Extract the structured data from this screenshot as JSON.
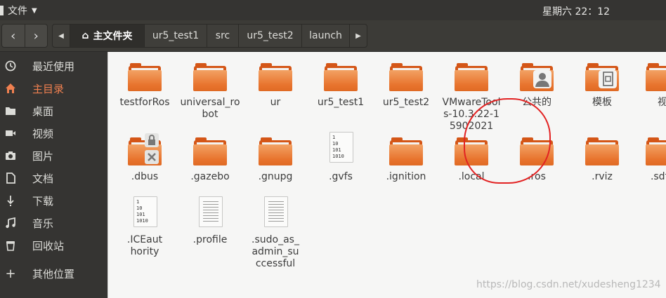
{
  "topbar": {
    "app_menu": "文件",
    "clock": "星期六 22：12"
  },
  "toolbar": {
    "path": [
      "主文件夹",
      "ur5_test1",
      "src",
      "ur5_test2",
      "launch"
    ]
  },
  "sidebar": {
    "items": [
      {
        "label": "最近使用",
        "icon": "clock-icon"
      },
      {
        "label": "主目录",
        "icon": "home-icon"
      },
      {
        "label": "桌面",
        "icon": "folder-icon"
      },
      {
        "label": "视频",
        "icon": "video-icon"
      },
      {
        "label": "图片",
        "icon": "camera-icon"
      },
      {
        "label": "文档",
        "icon": "document-icon"
      },
      {
        "label": "下载",
        "icon": "download-icon"
      },
      {
        "label": "音乐",
        "icon": "music-icon"
      },
      {
        "label": "回收站",
        "icon": "trash-icon"
      },
      {
        "label": "其他位置",
        "icon": "plus-icon"
      }
    ]
  },
  "files": [
    {
      "name": "testforRos",
      "type": "folder"
    },
    {
      "name": "universal_robot",
      "type": "folder"
    },
    {
      "name": "ur",
      "type": "folder"
    },
    {
      "name": "ur5_test1",
      "type": "folder"
    },
    {
      "name": "ur5_test2",
      "type": "folder"
    },
    {
      "name": "VMwareTools-10.3.22-15902021",
      "type": "folder"
    },
    {
      "name": "公共的",
      "type": "folder"
    },
    {
      "name": "模板",
      "type": "folder"
    },
    {
      "name": "视",
      "type": "folder"
    },
    {
      "name": ".dbus",
      "type": "folder"
    },
    {
      "name": ".gazebo",
      "type": "folder"
    },
    {
      "name": ".gnupg",
      "type": "folder"
    },
    {
      "name": ".gvfs",
      "type": "binary"
    },
    {
      "name": ".ignition",
      "type": "folder"
    },
    {
      "name": ".local",
      "type": "folder"
    },
    {
      "name": ".ros",
      "type": "folder"
    },
    {
      "name": ".rviz",
      "type": "folder"
    },
    {
      "name": ".sdfo",
      "type": "folder"
    },
    {
      "name": ".ICEauthority",
      "type": "binary"
    },
    {
      "name": ".profile",
      "type": "text"
    },
    {
      "name": ".sudo_as_admin_successful",
      "type": "text"
    }
  ],
  "binary_icon_text": "1\n10\n101\n1010",
  "watermark": "https://blog.csdn.net/xudesheng1234",
  "colors": {
    "accent": "#f08050",
    "folder": "#e8742e",
    "annotation": "#e22222"
  }
}
